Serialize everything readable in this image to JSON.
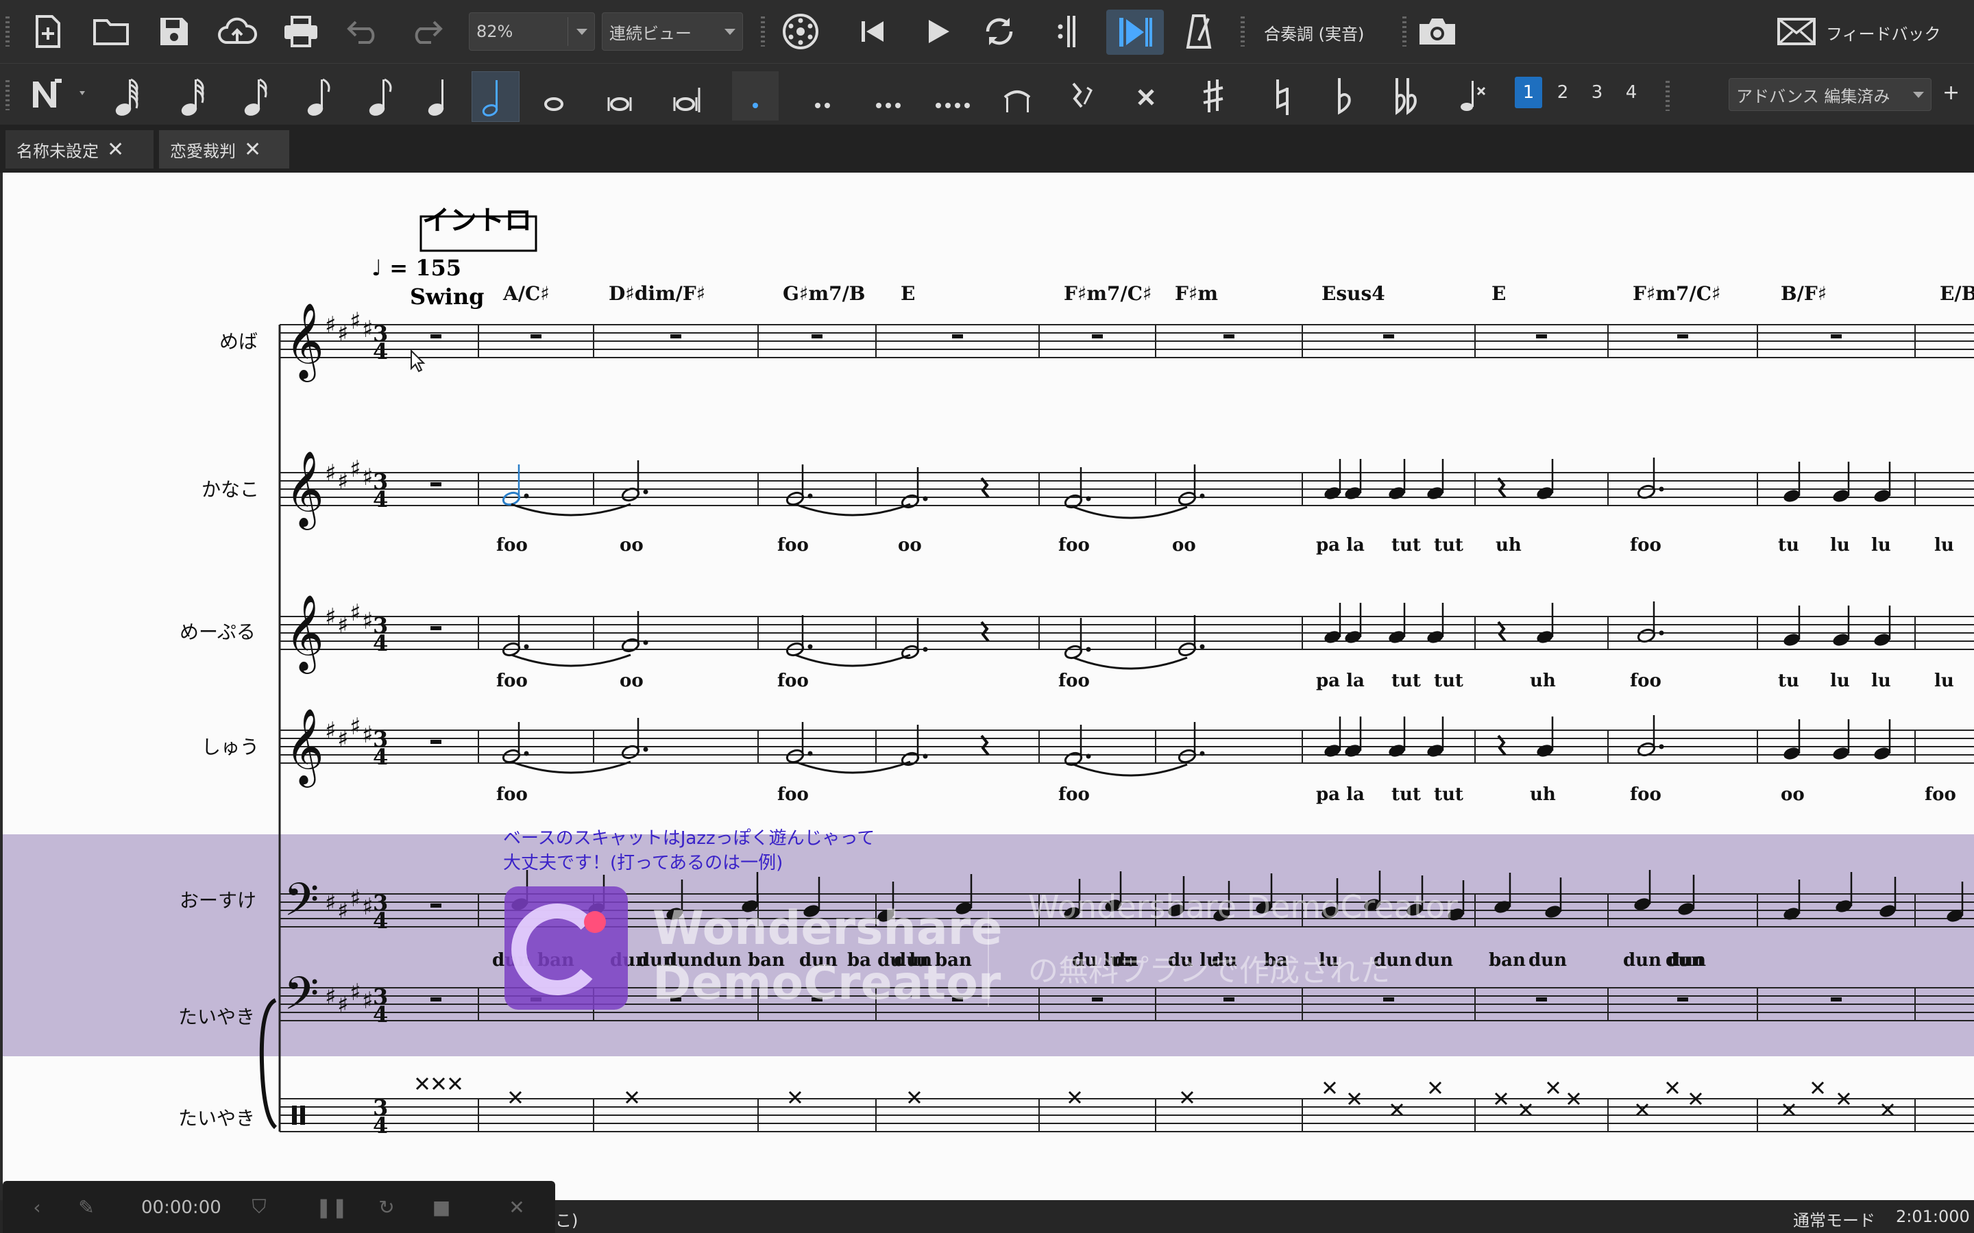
{
  "toolbar": {
    "zoom": "82%",
    "view_mode": "連続ビュー",
    "concert_pitch": "合奏調 (実音)",
    "feedback": "フィードバック",
    "workspace": "アドバンス 編集済み",
    "add": "+",
    "voices": [
      "1",
      "2",
      "3",
      "4"
    ]
  },
  "tabs": [
    {
      "label": "名称未設定",
      "close": "✕"
    },
    {
      "label": "恋愛裁判",
      "close": "✕"
    }
  ],
  "score": {
    "rehearsal_mark": "イントロ",
    "tempo": "♩ = 155",
    "style": "Swing",
    "chords": [
      "A/C♯",
      "D♯dim/F♯",
      "G♯m7/B",
      "E",
      "F♯m7/C♯",
      "F♯m",
      "Esus4",
      "E",
      "F♯m7/C♯",
      "B/F♯",
      "E/B"
    ],
    "staff_names": [
      "めば",
      "かなこ",
      "めーぷる",
      "しゅう",
      "おーすけ",
      "たいやき",
      "たいやき"
    ],
    "lyrics_kanako": [
      "foo",
      "oo",
      "foo",
      "oo",
      "foo",
      "oo",
      "pa la",
      "tut",
      "tut",
      "uh",
      "foo",
      "tu",
      "lu",
      "lu",
      "lu"
    ],
    "lyrics_maple": [
      "foo",
      "oo",
      "foo",
      "foo",
      "pa la",
      "tut",
      "tut",
      "uh",
      "foo",
      "tu",
      "lu",
      "lu",
      "lu"
    ],
    "lyrics_shu": [
      "foo",
      "foo",
      "foo",
      "pa la",
      "tut",
      "tut",
      "uh",
      "foo",
      "oo",
      "foo"
    ],
    "lyrics_osuke": [
      "dun",
      "ban",
      "dun",
      "dun",
      "dun",
      "dun ban",
      "dun",
      "ba du lu",
      "dun",
      "ban",
      "du lun",
      "du",
      "du lu",
      "du",
      "ba",
      "lu",
      "dun",
      "dun",
      "ban",
      "dun",
      "dun dun",
      "dun"
    ],
    "annotation_line1": "ベースのスキャットはJazzっぽく遊んじゃって",
    "annotation_line2": "大丈夫です！(打ってあるのは一例)"
  },
  "watermark": {
    "brand_line1": "Wondershare",
    "brand_line2": "DemoCreator",
    "ghost_line1": "Wondershare DemoCreator",
    "ghost_line2": "の無料プランで作成された"
  },
  "recorder": {
    "time": "00:00:00"
  },
  "status": {
    "partial": "こ)",
    "mode": "通常モード",
    "position": "2:01:000"
  }
}
